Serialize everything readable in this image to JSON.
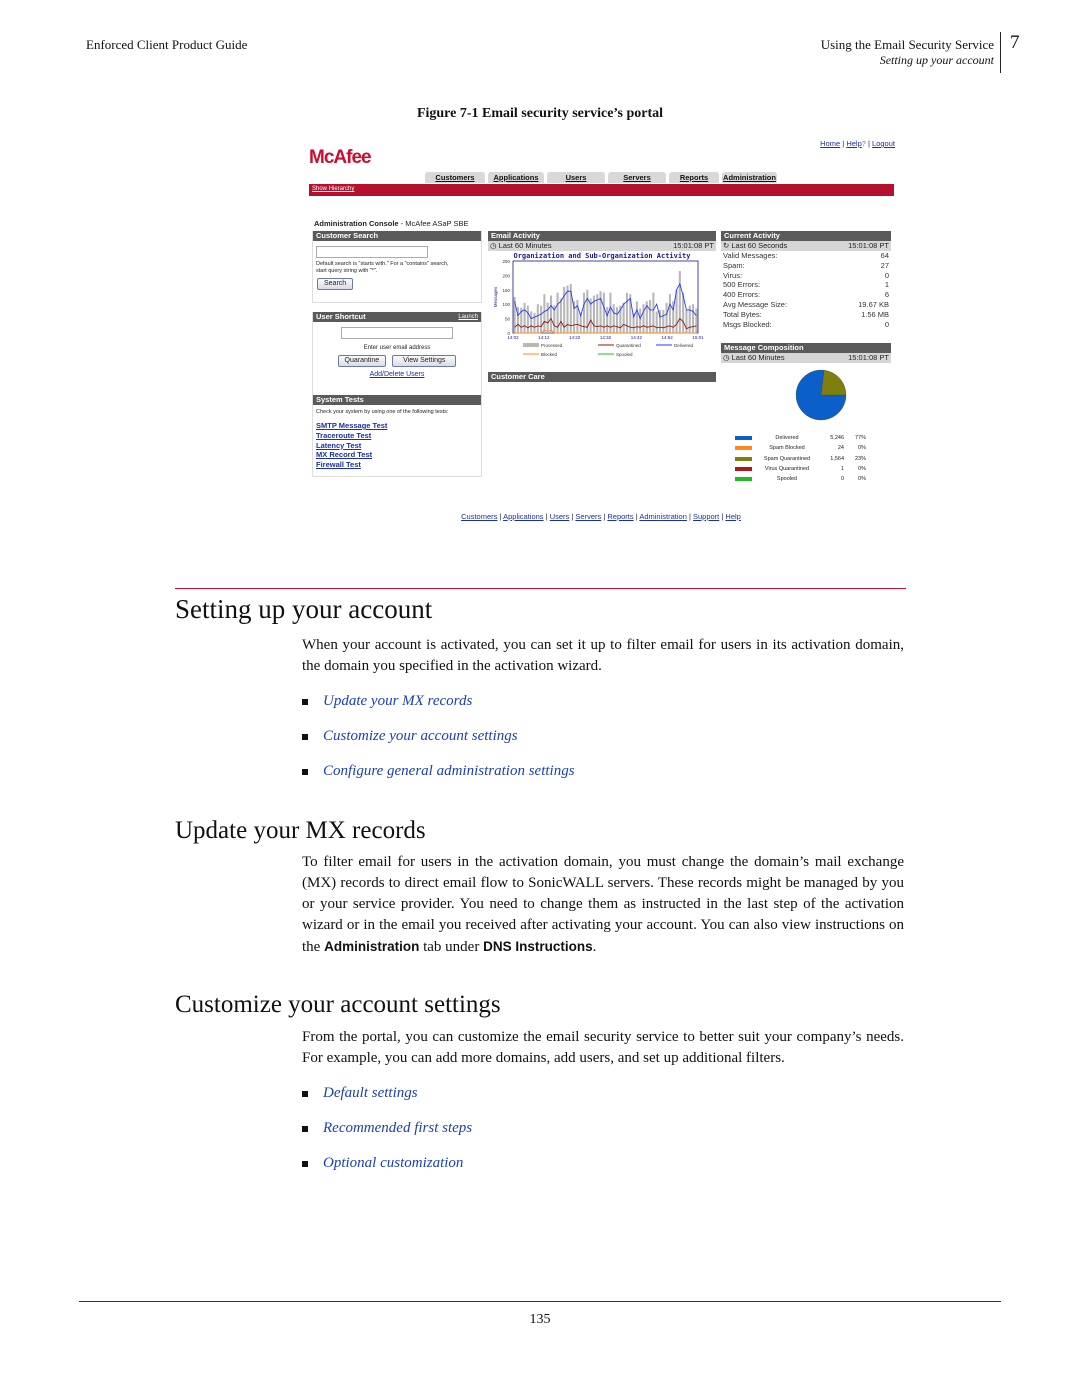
{
  "header": {
    "left": "Enforced Client Product Guide",
    "chapter_title": "Using the Email Security Service",
    "section_title": "Setting up your account",
    "chapter_number": "7"
  },
  "figure": {
    "caption": "Figure 7-1  Email security service’s portal"
  },
  "portal": {
    "logo": "McAfee",
    "top_links": [
      "Home",
      "Help",
      "Logout"
    ],
    "tabs": [
      "Customers",
      "Applications",
      "Users",
      "Servers",
      "Reports",
      "Administration"
    ],
    "show_hierarchy": "Show Hierarchy",
    "console_title": "Administration Console",
    "console_sub": " - McAfee ASaP SBE",
    "customer_search": {
      "title": "Customer Search",
      "hint": "Default search is \"starts with.\"  For a \"contains\" search, start query string with \"*\".",
      "button": "Search"
    },
    "user_shortcut": {
      "title": "User Shortcut",
      "launch": "Launch",
      "hint": "Enter user email address",
      "quarantine": "Quarantine",
      "view_settings": "View Settings",
      "add_delete": "Add/Delete Users"
    },
    "system_tests": {
      "title": "System Tests",
      "hint": "Check your system by using one of the following tests:",
      "tests": [
        "SMTP Message Test",
        "Traceroute Test",
        "Latency Test",
        "MX Record Test",
        "Firewall Test"
      ]
    },
    "email_activity": {
      "title": "Email Activity",
      "period": "Last 60 Minutes",
      "time": "15:01:08 PT"
    },
    "customer_care": {
      "title": "Customer Care"
    },
    "current_activity": {
      "title": "Current Activity",
      "period": "Last 60 Seconds",
      "time": "15:01:08 PT",
      "rows": [
        [
          "Valid Messages:",
          "64"
        ],
        [
          "Spam:",
          "27"
        ],
        [
          "Virus:",
          "0"
        ],
        [
          "500 Errors:",
          "1"
        ],
        [
          "400 Errors:",
          "6"
        ],
        [
          "Avg Message Size:",
          "19.67 KB"
        ],
        [
          "Total Bytes:",
          "1.56 MB"
        ],
        [
          "Msgs Blocked:",
          "0"
        ]
      ]
    },
    "message_composition": {
      "title": "Message Composition",
      "period": "Last 60 Minutes",
      "time": "15:01:08 PT",
      "legend": [
        {
          "label": "Delivered",
          "count": "5,246",
          "pct": "77%",
          "color": "#0a5fc8"
        },
        {
          "label": "Spam Blocked",
          "count": "24",
          "pct": "0%",
          "color": "#ff8a1a"
        },
        {
          "label": "Spam Quarantined",
          "count": "1,564",
          "pct": "23%",
          "color": "#7f7f10"
        },
        {
          "label": "Virus Quarantined",
          "count": "1",
          "pct": "0%",
          "color": "#b01818"
        },
        {
          "label": "Spooled",
          "count": "0",
          "pct": "0%",
          "color": "#22bb22"
        }
      ]
    },
    "footer_links": [
      "Customers",
      "Applications",
      "Users",
      "Servers",
      "Reports",
      "Administration",
      "Support",
      "Help"
    ]
  },
  "chart_data": {
    "type": "bar+line",
    "title": "Organization and Sub-Organization Activity",
    "ylabel": "Messages",
    "ylim": [
      0,
      250
    ],
    "yticks": [
      "0",
      "50",
      "100",
      "150",
      "200",
      "250"
    ],
    "xticks": [
      "14:02",
      "14:12",
      "14:22",
      "14:32",
      "14:42",
      "14:52",
      "15:01"
    ],
    "series": [
      {
        "name": "Processed",
        "type": "bar",
        "color": "#b8b8b8",
        "values": [
          125,
          90,
          88,
          105,
          95,
          75,
          70,
          100,
          95,
          135,
          105,
          130,
          95,
          140,
          120,
          160,
          165,
          170,
          110,
          115,
          70,
          140,
          150,
          120,
          130,
          135,
          145,
          140,
          90,
          140,
          100,
          90,
          95,
          105,
          140,
          135,
          70,
          110,
          85,
          100,
          110,
          115,
          140,
          75,
          80,
          80,
          105,
          135,
          110,
          150,
          215,
          140,
          80,
          95,
          100,
          85
        ]
      },
      {
        "name": "Quarantined",
        "type": "line",
        "color": "#8b1a1a",
        "values": [
          20,
          30,
          20,
          25,
          18,
          25,
          20,
          25,
          22,
          40,
          35,
          50,
          25,
          20,
          40,
          20,
          30,
          25,
          28,
          30,
          25,
          22,
          20,
          45,
          25,
          22,
          25,
          20,
          25,
          20,
          25,
          22,
          18,
          30,
          25,
          20,
          18,
          22,
          20,
          25,
          20,
          22,
          25,
          18,
          20,
          18,
          22,
          25,
          20,
          30,
          50,
          40,
          15,
          20,
          22,
          25
        ]
      },
      {
        "name": "Delivered",
        "type": "line",
        "color": "#2a3aff",
        "values": [
          110,
          60,
          75,
          80,
          70,
          50,
          55,
          60,
          65,
          75,
          80,
          95,
          80,
          100,
          110,
          130,
          145,
          145,
          85,
          95,
          60,
          100,
          120,
          100,
          110,
          115,
          120,
          90,
          60,
          90,
          70,
          65,
          80,
          100,
          110,
          120,
          55,
          80,
          50,
          75,
          95,
          80,
          80,
          100,
          55,
          60,
          65,
          100,
          80,
          150,
          170,
          130,
          80,
          80,
          75,
          60
        ]
      },
      {
        "name": "Blocked",
        "type": "line",
        "color": "#ff8a1a",
        "values": [
          0,
          0,
          0,
          0,
          0,
          0,
          0,
          0,
          0,
          10,
          5,
          10,
          0,
          0,
          0,
          0,
          0,
          0,
          0,
          0,
          0,
          0,
          0,
          0,
          0,
          0,
          0,
          0,
          0,
          0,
          0,
          0,
          0,
          0,
          0,
          0,
          0,
          0,
          0,
          0,
          0,
          0,
          0,
          0,
          0,
          0,
          0,
          0,
          0,
          0,
          0,
          0,
          0,
          0,
          0,
          0
        ]
      },
      {
        "name": "Spooled",
        "type": "line",
        "color": "#22bb22",
        "values": []
      }
    ]
  },
  "sections": [
    {
      "title": "Setting up your account",
      "body": "When your account is activated, you can set it up to filter email for users in its activation domain, the domain you specified in the activation wizard.",
      "links": [
        "Update your MX records",
        "Customize your account settings",
        "Configure general administration settings"
      ]
    },
    {
      "title": "Update your MX records",
      "body_a": "To filter email for users in the activation domain, you must change the domain’s mail exchange (MX) records to direct email flow to SonicWALL servers. These records might be managed by you or your service provider. You need to change them as instructed in the last step of the activation wizard or in the email you received after activating your account. You can also view instructions on the ",
      "bold1": "Administration",
      "body_b": " tab under ",
      "bold2": "DNS Instructions",
      "body_c": "."
    },
    {
      "title": "Customize your account settings",
      "body": "From the portal, you can customize the email security service to better suit your company’s needs. For example, you can add more domains, add users, and set up additional filters.",
      "links": [
        "Default settings",
        "Recommended first steps",
        "Optional customization"
      ]
    }
  ],
  "footer": {
    "page_number": "135"
  }
}
